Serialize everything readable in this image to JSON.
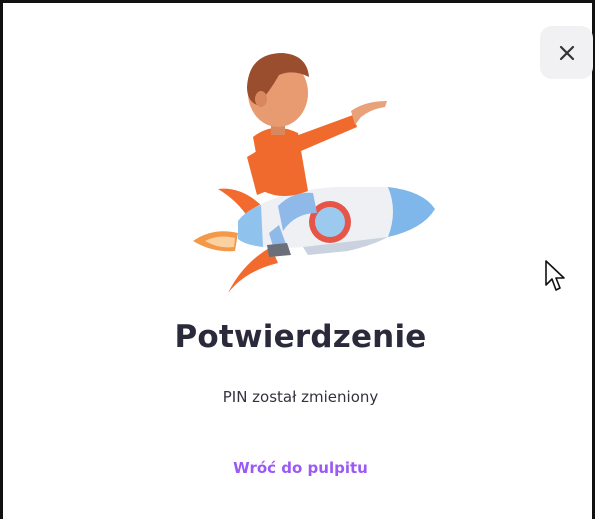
{
  "dialog": {
    "title": "Potwierdzenie",
    "message": "PIN został zmieniony",
    "back_link": "Wróć do pulpitu",
    "close_icon": "close-icon",
    "illustration": "boy-riding-rocket-illustration"
  },
  "colors": {
    "link": "#9b59f5",
    "title": "#2a2a3a",
    "close_bg": "#f1f1f4"
  }
}
